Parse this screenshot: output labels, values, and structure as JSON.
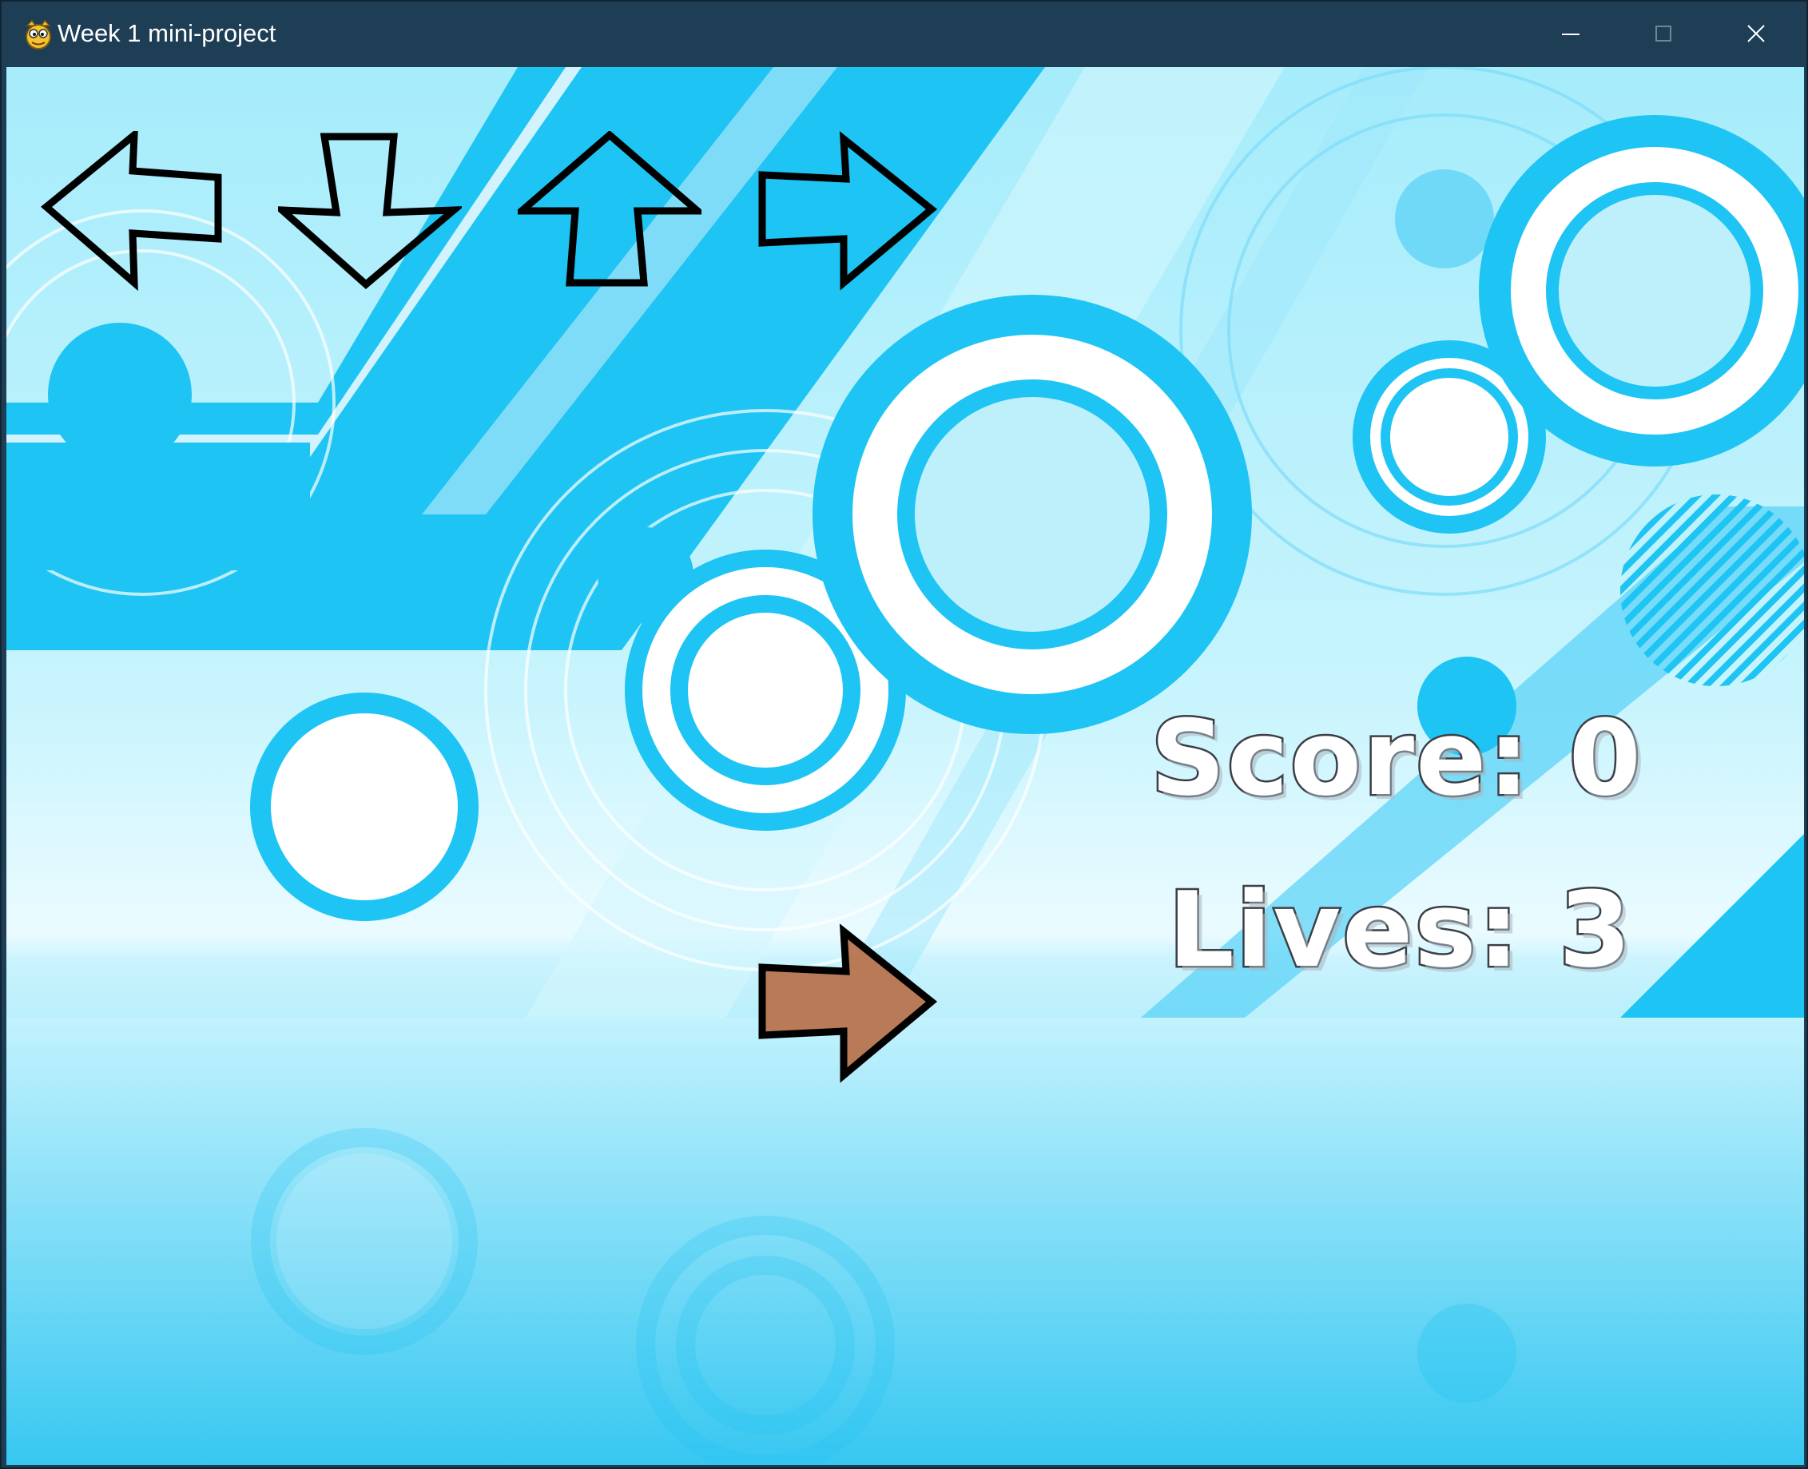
{
  "window": {
    "title": "Week 1 mini-project",
    "icon": "pygame-snake-icon",
    "controls": [
      "minimize-icon",
      "maximize-icon",
      "close-icon"
    ]
  },
  "game": {
    "target_arrows": [
      {
        "direction": "left",
        "icon": "left-arrow-icon"
      },
      {
        "direction": "down",
        "icon": "down-arrow-icon"
      },
      {
        "direction": "up",
        "icon": "up-arrow-icon"
      },
      {
        "direction": "right",
        "icon": "right-arrow-icon"
      }
    ],
    "falling_arrow": {
      "direction": "right",
      "color": "#b87a57",
      "icon": "right-arrow-icon"
    },
    "hud": {
      "score_text": "Score: 0",
      "lives_text": "Lives: 3"
    }
  },
  "colors": {
    "titlebar": "#1e3e56",
    "accent_blue": "#1ec4f3",
    "background_light": "#bdf0fb",
    "arrow_outline": "#000000"
  }
}
